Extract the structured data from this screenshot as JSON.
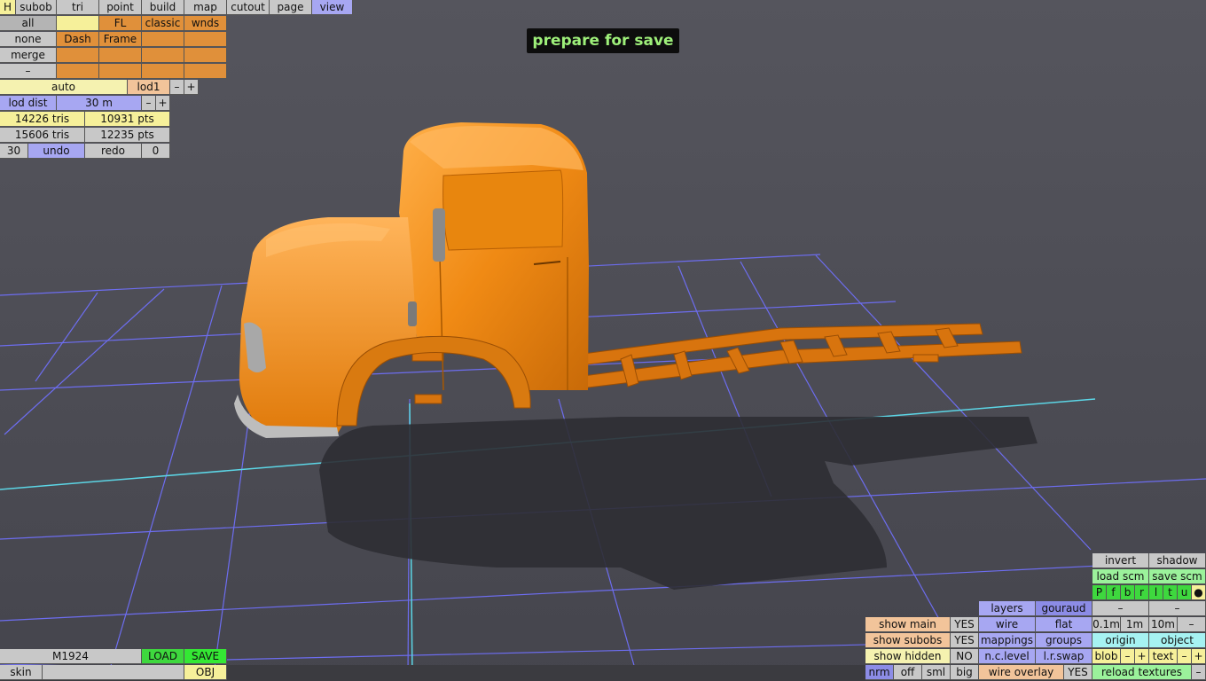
{
  "top_menu": [
    "H",
    "subob",
    "tri",
    "point",
    "build",
    "map",
    "cutout",
    "page",
    "view"
  ],
  "sel_grid": {
    "row1": [
      "all",
      "",
      "FL",
      "classic",
      "wnds"
    ],
    "row2": [
      "none",
      "Dash",
      "Frame",
      "",
      ""
    ],
    "row3": [
      "merge",
      "",
      "",
      "",
      ""
    ],
    "row4": [
      "–",
      "",
      "",
      "",
      ""
    ]
  },
  "lod": {
    "mode": "auto",
    "level": "lod1",
    "minus": "–",
    "plus": "+"
  },
  "lod_dist": {
    "label": "lod dist",
    "value": "30 m",
    "minus": "–",
    "plus": "+"
  },
  "stats": {
    "tris_a": "14226 tris",
    "pts_a": "10931 pts",
    "tris_b": "15606 tris",
    "pts_b": "12235 pts"
  },
  "undo_row": {
    "undo_count": "30",
    "undo": "undo",
    "redo": "redo",
    "redo_count": "0"
  },
  "banner": "prepare for save",
  "file_panel": {
    "name": "M1924",
    "load": "LOAD",
    "save": "SAVE",
    "skin": "skin",
    "obj": "OBJ"
  },
  "right_panel": {
    "invert": "invert",
    "shadow": "shadow",
    "load_scm": "load scm",
    "save_scm": "save scm",
    "toggles": [
      "P",
      "f",
      "b",
      "r",
      "l",
      "t",
      "u",
      "●"
    ],
    "layers": "layers",
    "gouraud": "gouraud",
    "dash1": "–",
    "dash2": "–",
    "show_main": "show main",
    "show_main_val": "YES",
    "wire": "wire",
    "flat": "flat",
    "grid_sizes": [
      "0.1m",
      "1m",
      "10m"
    ],
    "grid_minus": "–",
    "show_subobs": "show subobs",
    "show_subobs_val": "YES",
    "mappings": "mappings",
    "groups": "groups",
    "origin": "origin",
    "object": "object",
    "show_hidden": "show hidden",
    "show_hidden_val": "NO",
    "nc_level": "n.c.level",
    "lr_swap": "l.r.swap",
    "blob": "blob",
    "blob_minus": "–",
    "blob_plus": "+",
    "text": "text",
    "text_minus": "–",
    "text_plus": "+",
    "view_modes": [
      "nrm",
      "off",
      "sml",
      "big"
    ],
    "wire_overlay": "wire overlay",
    "wire_overlay_val": "YES",
    "reload_textures": "reload textures",
    "reload_minus": "–"
  },
  "colors": {
    "background": "#4a4a52",
    "truck": "#f08a14",
    "grid": "#6d6df0",
    "axis": "#5cd6e6",
    "banner_text": "#9ef07a"
  }
}
